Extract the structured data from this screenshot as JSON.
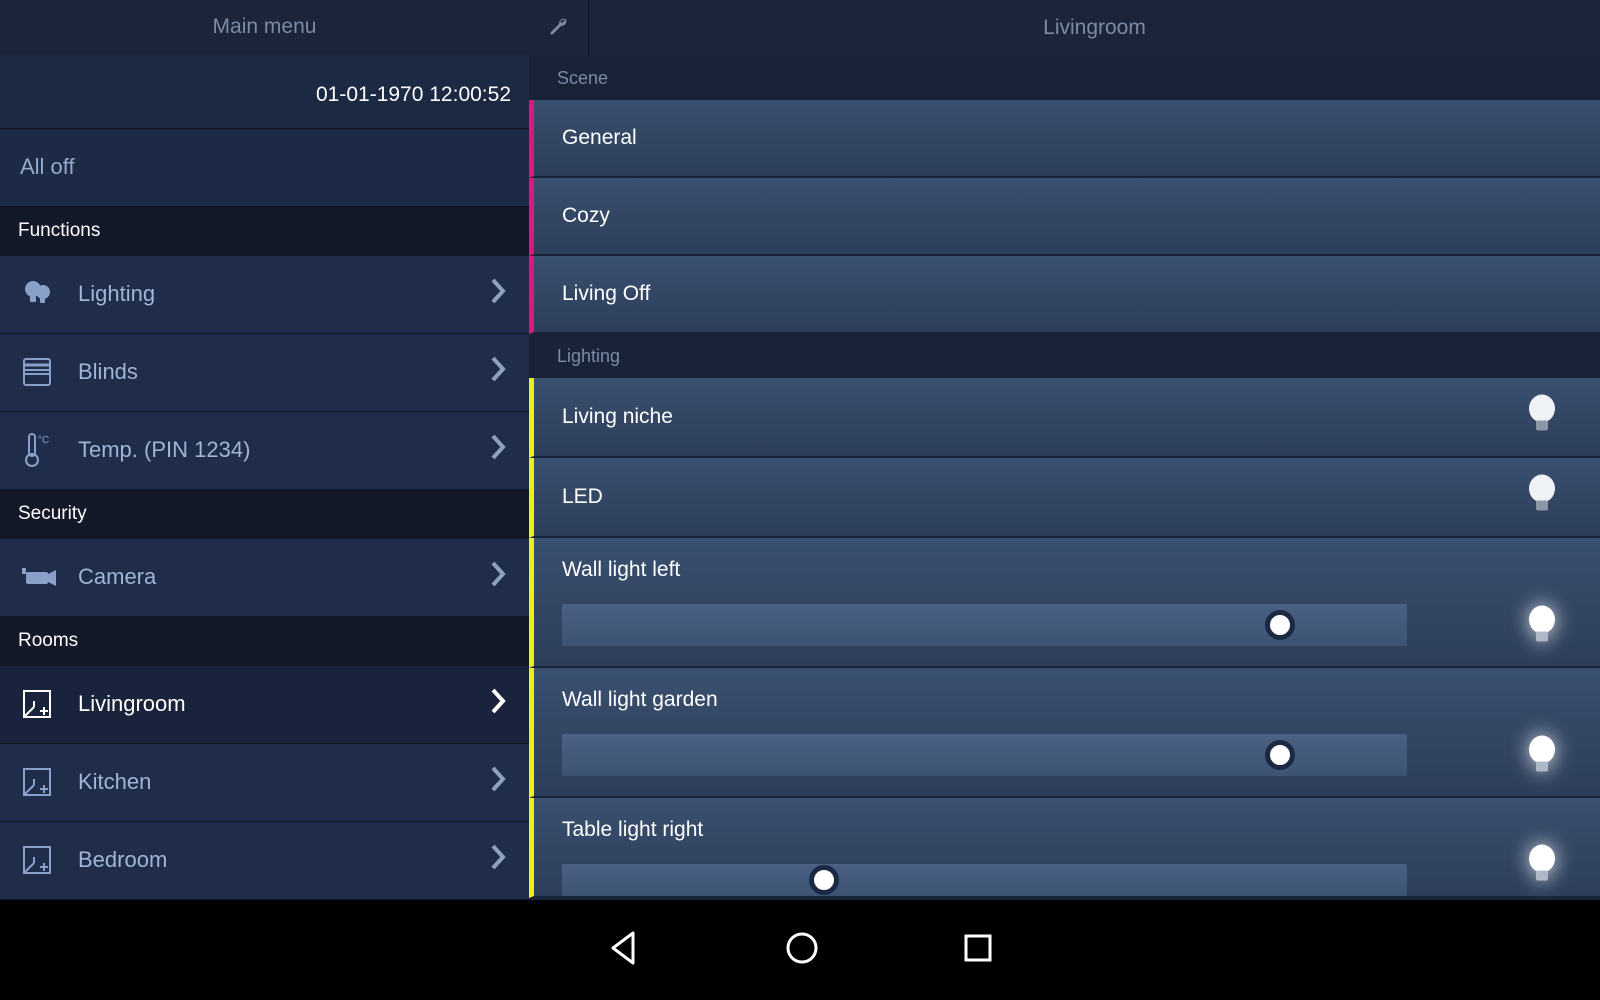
{
  "sidebar": {
    "title": "Main menu",
    "datetime": "01-01-1970 12:00:52",
    "all_off": "All off",
    "sections": {
      "functions": "Functions",
      "security": "Security",
      "rooms": "Rooms"
    },
    "functions": [
      {
        "label": "Lighting",
        "icon": "bulbs"
      },
      {
        "label": "Blinds",
        "icon": "blinds"
      },
      {
        "label": "Temp. (PIN 1234)",
        "icon": "thermo"
      }
    ],
    "security": [
      {
        "label": "Camera",
        "icon": "camera"
      }
    ],
    "rooms": [
      {
        "label": "Livingroom",
        "icon": "room",
        "active": true
      },
      {
        "label": "Kitchen",
        "icon": "room"
      },
      {
        "label": "Bedroom",
        "icon": "room"
      }
    ]
  },
  "main": {
    "title": "Livingroom",
    "groups": {
      "scene": "Scene",
      "lighting": "Lighting"
    },
    "scenes": [
      {
        "label": "General"
      },
      {
        "label": "Cozy"
      },
      {
        "label": "Living Off"
      }
    ],
    "lights": [
      {
        "label": "Living niche",
        "type": "simple",
        "glow": false
      },
      {
        "label": "LED",
        "type": "simple",
        "glow": false
      },
      {
        "label": "Wall light left",
        "type": "slider",
        "glow": true,
        "slider": 85
      },
      {
        "label": "Wall light garden",
        "type": "slider",
        "glow": true,
        "slider": 85
      },
      {
        "label": "Table light right",
        "type": "slider",
        "glow": true,
        "slider": 31
      }
    ]
  },
  "colors": {
    "scene_accent": "#e6147e",
    "light_accent": "#e7f315"
  }
}
